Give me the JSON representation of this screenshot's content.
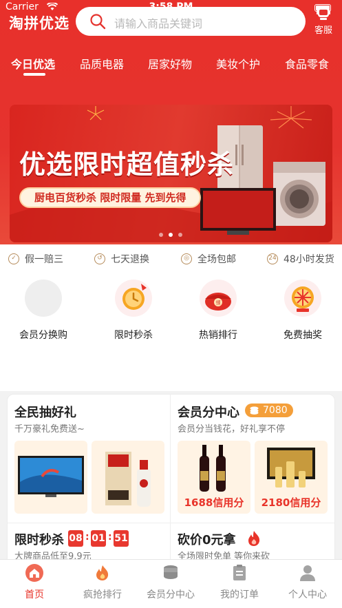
{
  "status_bar": {
    "carrier": "Carrier",
    "time": "3:58 PM"
  },
  "header": {
    "logo": "淘拼优选",
    "search_placeholder": "请输入商品关键词",
    "service_label": "客服"
  },
  "tabs": [
    {
      "label": "今日优选",
      "active": true
    },
    {
      "label": "品质电器",
      "active": false
    },
    {
      "label": "居家好物",
      "active": false
    },
    {
      "label": "美妆个护",
      "active": false
    },
    {
      "label": "食品零食",
      "active": false
    }
  ],
  "banner": {
    "title": "优选限时超值秒杀",
    "subtitle": "厨电百货秒杀 限时限量 先到先得",
    "slide_count": 3,
    "active_slide": 2
  },
  "promises": [
    {
      "icon": "shield-icon",
      "label": "假一赔三"
    },
    {
      "icon": "return-icon",
      "label": "七天退换"
    },
    {
      "icon": "shipping-icon",
      "label": "全场包邮"
    },
    {
      "icon": "24h-icon",
      "icon_text": "24",
      "label": "48小时发货"
    }
  ],
  "categories": [
    {
      "icon": "member-exchange-icon",
      "label": "会员分换购"
    },
    {
      "icon": "alarm-clock-icon",
      "label": "限时秒杀"
    },
    {
      "icon": "red-envelope-icon",
      "label": "热销排行"
    },
    {
      "icon": "prize-wheel-icon",
      "label": "免费抽奖"
    }
  ],
  "cards": {
    "lottery": {
      "title": "全民抽好礼",
      "subtitle": "千万豪礼免费送~"
    },
    "points": {
      "title": "会员分中心",
      "badge": "7080",
      "subtitle": "会员分当钱花，好礼享不停",
      "items": [
        {
          "price": "1688信用分"
        },
        {
          "price": "2180信用分"
        }
      ]
    },
    "flash": {
      "title": "限时秒杀",
      "timer": [
        "08",
        "01",
        "51"
      ],
      "subtitle": "大牌商品低至9.9元"
    },
    "bargain": {
      "title": "砍价0元拿",
      "subtitle": "全场限时免单 等你来砍"
    }
  },
  "tabbar": [
    {
      "label": "首页",
      "icon": "home-icon",
      "active": true
    },
    {
      "label": "疯抢排行",
      "icon": "flame-icon",
      "active": false
    },
    {
      "label": "会员分中心",
      "icon": "coins-icon",
      "active": false
    },
    {
      "label": "我的订单",
      "icon": "order-icon",
      "active": false
    },
    {
      "label": "个人中心",
      "icon": "user-icon",
      "active": false
    }
  ],
  "colors": {
    "brand_red": "#e5332e",
    "accent_orange": "#f49f3a",
    "price_red": "#e8342a",
    "promise_gold": "#b58b5a"
  }
}
